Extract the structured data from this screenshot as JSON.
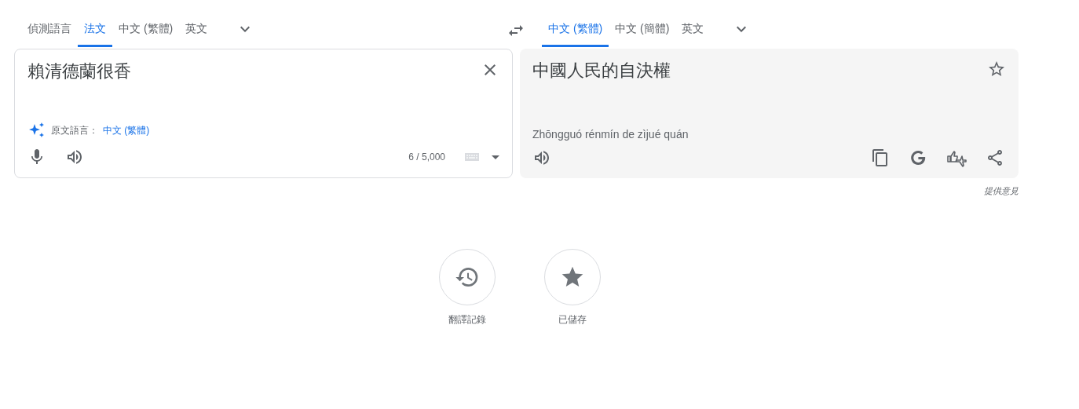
{
  "source_languages": [
    {
      "label": "偵測語言",
      "selected": false
    },
    {
      "label": "法文",
      "selected": true
    },
    {
      "label": "中文 (繁體)",
      "selected": false
    },
    {
      "label": "英文",
      "selected": false
    }
  ],
  "target_languages": [
    {
      "label": "中文 (繁體)",
      "selected": true
    },
    {
      "label": "中文 (簡體)",
      "selected": false
    },
    {
      "label": "英文",
      "selected": false
    }
  ],
  "source": {
    "text": "賴清德蘭很香",
    "detected_label": "原文語言：",
    "detected_language": "中文 (繁體)",
    "char_count": "6 / 5,000"
  },
  "target": {
    "text": "中國人民的自決權",
    "romanization": "Zhōngguó rénmín de zìjué quán",
    "saved": false
  },
  "feedback": "提供意見",
  "shortcuts": [
    {
      "kind": "history",
      "label": "翻譯記錄"
    },
    {
      "kind": "saved",
      "label": "已儲存"
    }
  ]
}
